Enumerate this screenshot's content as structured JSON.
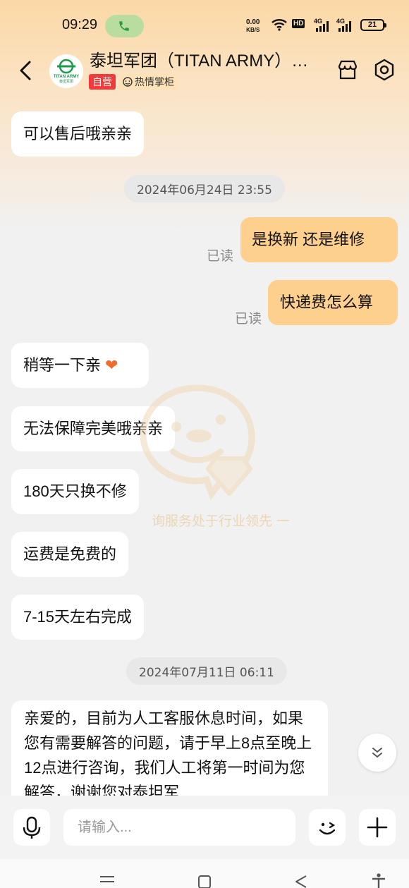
{
  "status_bar": {
    "time": "09:29",
    "net_speed_value": "0.00",
    "net_speed_unit": "KB/S",
    "hd_label": "HD",
    "signal_1_label": "4G",
    "signal_2_label": "4G",
    "battery": "21"
  },
  "header": {
    "shop_name": "泰坦军团（TITAN ARMY）…",
    "logo_text": "TITAN ARMY",
    "logo_subtext": "泰坦军团",
    "badge_self": "自营",
    "badge_host": "热情掌柜"
  },
  "messages": [
    {
      "side": "left",
      "text": "可以售后哦亲亲"
    },
    {
      "type": "timestamp",
      "text": "2024年06月24日  23:55"
    },
    {
      "side": "right",
      "text": "是换新  还是维修",
      "read": "已读"
    },
    {
      "side": "right",
      "text": "快递费怎么算",
      "read": "已读"
    },
    {
      "side": "left",
      "text": "稍等一下亲",
      "emoji": "❤"
    },
    {
      "side": "left",
      "text": "无法保障完美哦亲亲"
    },
    {
      "side": "left",
      "text": "180天只换不修"
    },
    {
      "side": "left",
      "text": "运费是免费的"
    },
    {
      "side": "left",
      "text": "7-15天左右完成"
    },
    {
      "type": "timestamp",
      "text": "2024年07月11日  06:11"
    },
    {
      "side": "left",
      "text": "亲爱的，目前为人工客服休息时间，如果您有需要解答的问题，请于早上8点至晚上12点进行咨询，我们人工将第一时间为您解答，谢谢您对泰坦军"
    }
  ],
  "watermark_text": "询服务处于行业领先  一",
  "input": {
    "placeholder": "请输入..."
  },
  "colors": {
    "accent_orange": "#fdd08e",
    "badge_red": "#f33a3a",
    "background": "#f1f1f1"
  }
}
